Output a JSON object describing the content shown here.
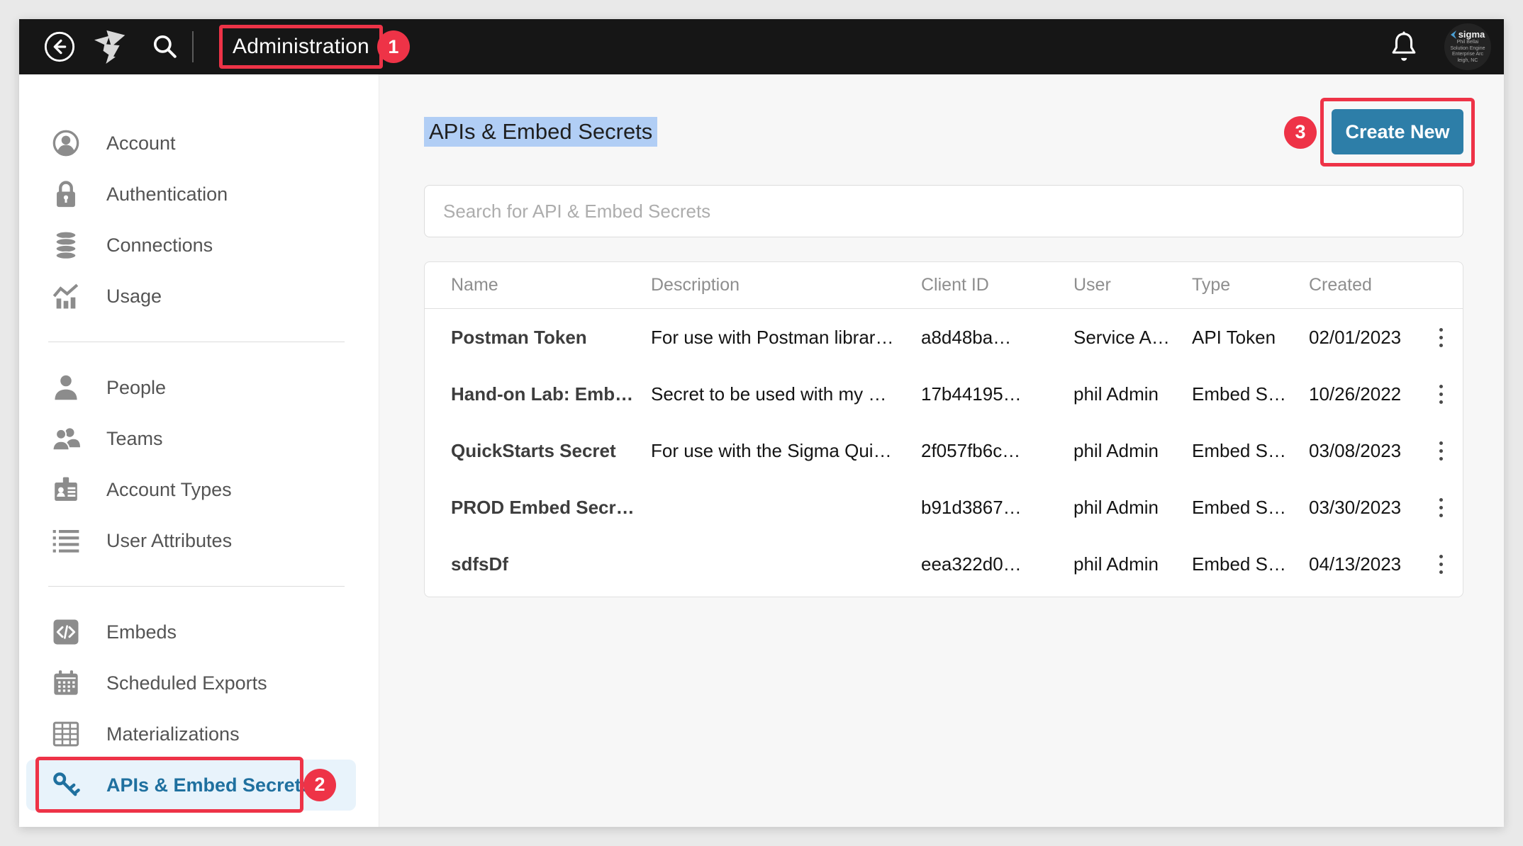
{
  "colors": {
    "accent_blue": "#1f709f",
    "button_blue": "#2d7ea8",
    "annotation_red": "#ee3347",
    "active_item_bg": "#e8f3fb",
    "title_selection": "#b1cef5",
    "topbar_bg": "#161616"
  },
  "annotations": {
    "step1": "1",
    "step2": "2",
    "step3": "3"
  },
  "topbar": {
    "title": "Administration"
  },
  "avatar": {
    "brand": "sigma",
    "line1": "Phil Bellai",
    "line2": "Solution Engine",
    "line3": "Enterprise Arc",
    "line4": "leigh, NC"
  },
  "sidebar": {
    "groups": [
      {
        "items": [
          {
            "label": "Account",
            "icon": "account-icon"
          },
          {
            "label": "Authentication",
            "icon": "lock-icon"
          },
          {
            "label": "Connections",
            "icon": "database-icon"
          },
          {
            "label": "Usage",
            "icon": "usage-chart-icon"
          }
        ]
      },
      {
        "items": [
          {
            "label": "People",
            "icon": "person-icon"
          },
          {
            "label": "Teams",
            "icon": "teams-icon"
          },
          {
            "label": "Account Types",
            "icon": "id-badge-icon"
          },
          {
            "label": "User Attributes",
            "icon": "list-icon"
          }
        ]
      },
      {
        "items": [
          {
            "label": "Embeds",
            "icon": "code-icon"
          },
          {
            "label": "Scheduled Exports",
            "icon": "calendar-icon"
          },
          {
            "label": "Materializations",
            "icon": "table-icon"
          },
          {
            "label": "APIs & Embed Secrets",
            "icon": "key-icon",
            "active": true
          }
        ]
      }
    ]
  },
  "main": {
    "title": "APIs & Embed Secrets",
    "create_button": "Create New",
    "search_placeholder": "Search for API & Embed Secrets",
    "table": {
      "columns": [
        "Name",
        "Description",
        "Client ID",
        "User",
        "Type",
        "Created"
      ],
      "rows": [
        {
          "name": "Postman Token",
          "description": "For use with Postman librar…",
          "client_id": "a8d48ba…",
          "user": "Service A…",
          "type": "API Token",
          "created": "02/01/2023"
        },
        {
          "name": "Hand-on Lab: Emb…",
          "description": "Secret to be used with my …",
          "client_id": "17b44195…",
          "user": "phil Admin",
          "type": "Embed S…",
          "created": "10/26/2022"
        },
        {
          "name": "QuickStarts Secret",
          "description": "For use with the Sigma Qui…",
          "client_id": "2f057fb6c…",
          "user": "phil Admin",
          "type": "Embed S…",
          "created": "03/08/2023"
        },
        {
          "name": "PROD Embed Secr…",
          "description": "",
          "client_id": "b91d3867…",
          "user": "phil Admin",
          "type": "Embed S…",
          "created": "03/30/2023"
        },
        {
          "name": "sdfsDf",
          "description": "",
          "client_id": "eea322d0…",
          "user": "phil Admin",
          "type": "Embed S…",
          "created": "04/13/2023"
        }
      ]
    }
  }
}
